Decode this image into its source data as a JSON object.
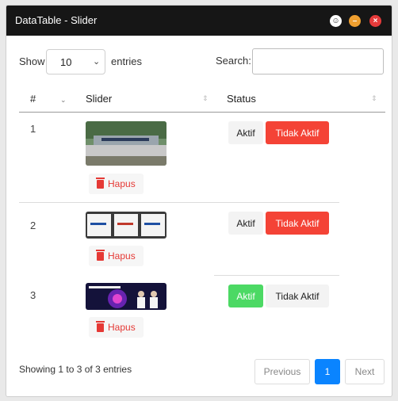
{
  "window": {
    "title": "DataTable - Slider"
  },
  "controls": {
    "length_label_before": "Show",
    "length_value": "10",
    "length_label_after": "entries",
    "search_label": "Search:",
    "search_value": ""
  },
  "table": {
    "headers": [
      "#",
      "Slider",
      "Status"
    ],
    "rows": [
      {
        "num": "1",
        "delete_label": "Hapus",
        "aktif_label": "Aktif",
        "tidak_label": "Tidak Aktif",
        "status": "Tidak Aktif"
      },
      {
        "num": "2",
        "delete_label": "Hapus",
        "aktif_label": "Aktif",
        "tidak_label": "Tidak Aktif",
        "status": "Tidak Aktif"
      },
      {
        "num": "3",
        "delete_label": "Hapus",
        "aktif_label": "Aktif",
        "tidak_label": "Tidak Aktif",
        "status": "Aktif"
      }
    ]
  },
  "footer": {
    "info": "Showing 1 to 3 of 3 entries",
    "previous_label": "Previous",
    "page_label": "1",
    "next_label": "Next"
  },
  "colors": {
    "titlebar": "#161616",
    "danger": "#f44336",
    "success": "#4cd964",
    "primary": "#0a84ff"
  }
}
